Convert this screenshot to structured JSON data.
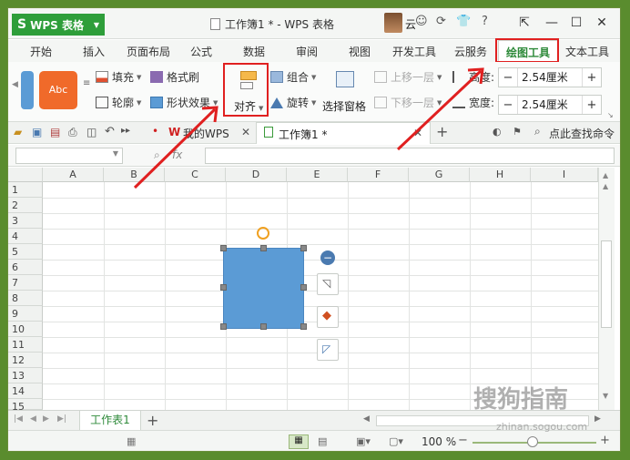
{
  "app": {
    "name": "WPS 表格",
    "logo": "S"
  },
  "window": {
    "title": "工作簿1 * - WPS 表格",
    "user": "云"
  },
  "menu_tabs": [
    "开始",
    "插入",
    "页面布局",
    "公式",
    "数据",
    "审阅",
    "视图",
    "开发工具",
    "云服务",
    "绘图工具",
    "文本工具"
  ],
  "active_tab": "绘图工具",
  "ribbon": {
    "style_preview": "Abc",
    "fill": "填充",
    "format_painter": "格式刷",
    "outline": "轮廓",
    "shape_effects": "形状效果",
    "align": "对齐",
    "group": "组合",
    "rotate": "旋转",
    "selection_pane": "选择窗格",
    "bring_forward": "上移一层",
    "send_backward": "下移一层",
    "height_label": "高度:",
    "height_value": "2.54厘米",
    "width_label": "宽度:",
    "width_value": "2.54厘米"
  },
  "doc_tabs": {
    "my_wps": "我的WPS",
    "workbook": "工作簿1 *",
    "search": "点此查找命令"
  },
  "formula_bar": {
    "fx": "fx"
  },
  "columns": [
    "A",
    "B",
    "C",
    "D",
    "E",
    "F",
    "G",
    "H",
    "I"
  ],
  "rows": [
    "1",
    "2",
    "3",
    "4",
    "5",
    "6",
    "7",
    "8",
    "9",
    "10",
    "11",
    "12",
    "13",
    "14",
    "15"
  ],
  "sheet_tab": "工作表1",
  "status": {
    "zoom": "100 %"
  },
  "watermark": {
    "brand": "搜狗指南",
    "url": "zhinan.sogou.com"
  },
  "colors": {
    "accent": "#2e9e3a",
    "shape_fill": "#5b9bd5",
    "style_preview": "#f06a2a",
    "highlight": "#e02020"
  }
}
